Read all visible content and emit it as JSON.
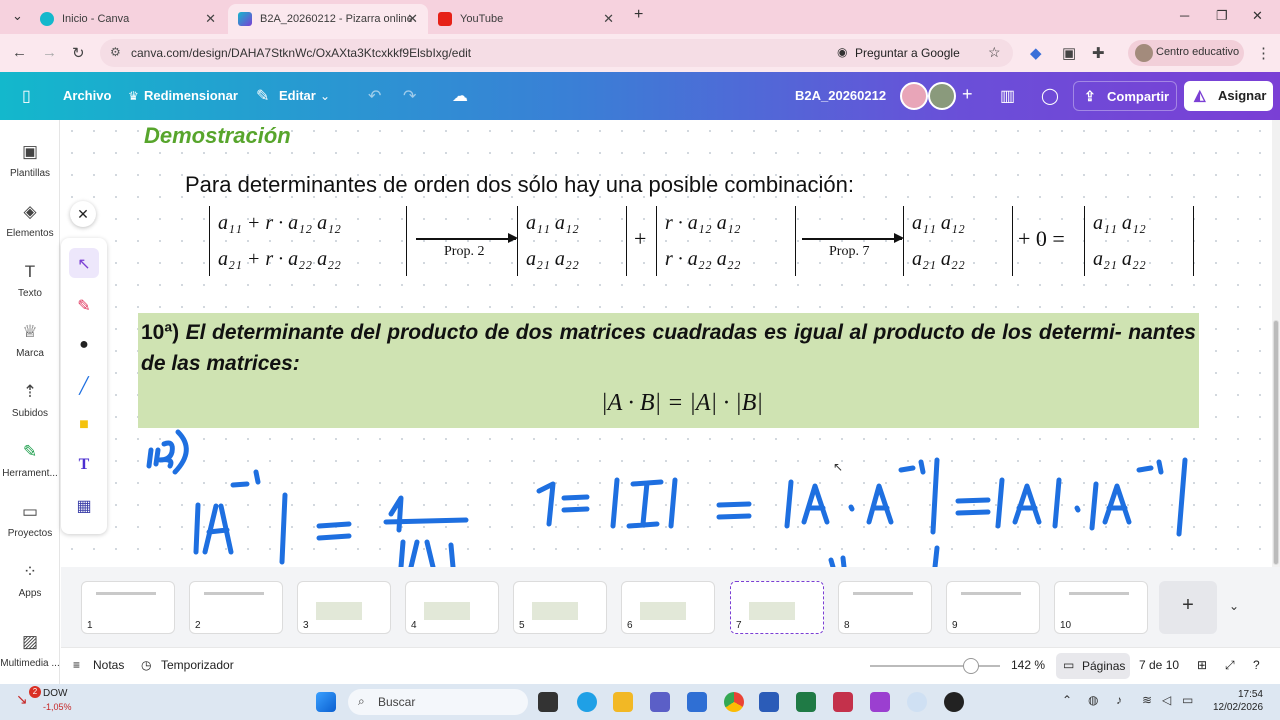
{
  "browser": {
    "tabs": [
      {
        "title": "Inicio - Canva"
      },
      {
        "title": "B2A_20260212 - Pizarra online"
      },
      {
        "title": "YouTube"
      }
    ],
    "url": "canva.com/design/DAHA7StknWc/OxAXta3Ktcxkkf9ElsbIxg/edit",
    "ask_google": "Preguntar a Google",
    "profile": "Centro educativo"
  },
  "topbar": {
    "archivo": "Archivo",
    "redimensionar": "Redimensionar",
    "editar": "Editar",
    "doc_title": "B2A_20260212",
    "compartir": "Compartir",
    "asignar": "Asignar"
  },
  "sidebar": {
    "items": [
      {
        "label": "Plantillas"
      },
      {
        "label": "Elementos"
      },
      {
        "label": "Texto"
      },
      {
        "label": "Marca"
      },
      {
        "label": "Subidos"
      },
      {
        "label": "Herrament..."
      },
      {
        "label": "Proyectos"
      },
      {
        "label": "Apps"
      },
      {
        "label": "Multimedia ..."
      }
    ]
  },
  "slide": {
    "demo_title": "Demostración",
    "paragraph": "Para determinantes de orden dos sólo hay una posible combinación:",
    "prop2": "Prop. 2",
    "prop7": "Prop. 7",
    "plus": "+",
    "plus_zero_eq": "+ 0 =",
    "det1_r1": "a₁₁ + r · a₁₂    a₁₂",
    "det1_r2": "a₂₁ + r · a₂₂    a₂₂",
    "det2_r1": "a₁₁    a₁₂",
    "det2_r2": "a₂₁    a₂₂",
    "det3_r1": "r · a₁₂    a₁₂",
    "det3_r2": "r · a₂₂    a₂₂",
    "det4_r1": "a₁₁    a₁₂",
    "det4_r2": "a₂₁    a₂₂",
    "det5_r1": "a₁₁    a₁₂",
    "det5_r2": "a₂₁    a₂₂",
    "theorem_num": "10ª)",
    "theorem_text": " El determinante del producto de dos matrices cuadradas es igual al producto de los determi- nantes de las matrices:",
    "formula": "|A · B| = |A| · |B|"
  },
  "pages": {
    "thumbs": [
      "1",
      "2",
      "3",
      "4",
      "5",
      "6",
      "7",
      "8",
      "9",
      "10"
    ],
    "selected": 7
  },
  "footer": {
    "notas": "Notas",
    "temporizador": "Temporizador",
    "zoom": "142 %",
    "paginas": "Páginas",
    "page_of": "7 de 10"
  },
  "taskbar": {
    "stock_name": "DOW",
    "stock_change": "-1,05%",
    "stock_badge": "2",
    "search": "Buscar",
    "time": "17:54",
    "date": "12/02/2026"
  },
  "colors": {
    "green_box": "#cfe3b2",
    "title_green": "#57a52c",
    "ink_blue": "#1e6fe0",
    "accent_purple": "#7b3fd4"
  }
}
